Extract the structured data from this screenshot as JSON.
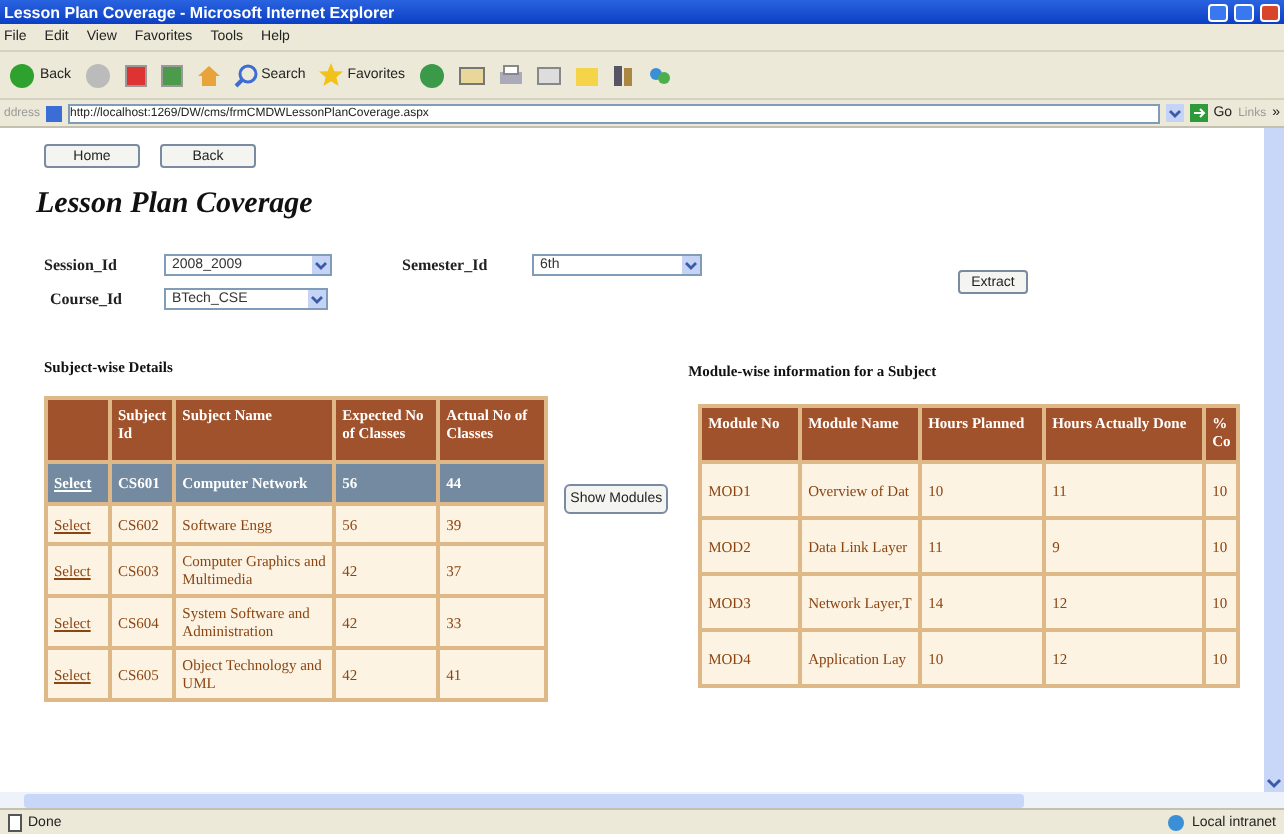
{
  "window": {
    "title": "Lesson Plan Coverage - Microsoft Internet Explorer"
  },
  "menu": [
    "File",
    "Edit",
    "View",
    "Favorites",
    "Tools",
    "Help"
  ],
  "toolbar": {
    "back": "Back",
    "search": "Search",
    "favorites": "Favorites"
  },
  "address": {
    "label": "ddress",
    "url": "http://localhost:1269/DW/cms/frmCMDWLessonPlanCoverage.aspx",
    "go": "Go",
    "links": "Links",
    "more": "»"
  },
  "nav_buttons": [
    "Home",
    "Back"
  ],
  "page_title": "Lesson Plan Coverage",
  "filters": [
    {
      "label": "Session_Id",
      "value": "2008_2009"
    },
    {
      "label": "Semester_Id",
      "value": "6th"
    },
    {
      "label": "Course_Id",
      "value": "BTech_CSE"
    }
  ],
  "extract_button": "Extract",
  "subject_table": {
    "heading": "Subject-wise Details",
    "columns": [
      "",
      "Subject Id",
      "Subject Name",
      "Expected No of Classes",
      "Actual No of Classes"
    ],
    "rows": [
      {
        "cells": [
          "Select",
          "CS601",
          "Computer Network",
          "56",
          "44"
        ],
        "selected": true
      },
      {
        "cells": [
          "Select",
          "CS602",
          "Software Engg",
          "56",
          "39"
        ],
        "selected": false
      },
      {
        "cells": [
          "Select",
          "CS603",
          "Computer Graphics and Multimedia",
          "42",
          "37"
        ],
        "selected": false
      },
      {
        "cells": [
          "Select",
          "CS604",
          "System Software and Administration",
          "42",
          "33"
        ],
        "selected": false
      },
      {
        "cells": [
          "Select",
          "CS605",
          "Object Technology and UML",
          "42",
          "41"
        ],
        "selected": false
      }
    ]
  },
  "show_modules_button": "Show Modules",
  "module_table": {
    "heading": "Module-wise information for a Subject",
    "columns": [
      "Module No",
      "Module Name",
      "Hours Planned",
      "Hours Actually Done",
      "% Co"
    ],
    "rows": [
      [
        "MOD1",
        "Overview of Dat",
        "10",
        "11",
        "10"
      ],
      [
        "MOD2",
        "Data Link Layer",
        "11",
        "9",
        "10"
      ],
      [
        "MOD3",
        "Network Layer,T",
        "14",
        "12",
        "10"
      ],
      [
        "MOD4",
        "Application Lay",
        "10",
        "12",
        "10"
      ]
    ]
  },
  "status_bar": {
    "text": "Done",
    "zone": "Local intranet"
  }
}
